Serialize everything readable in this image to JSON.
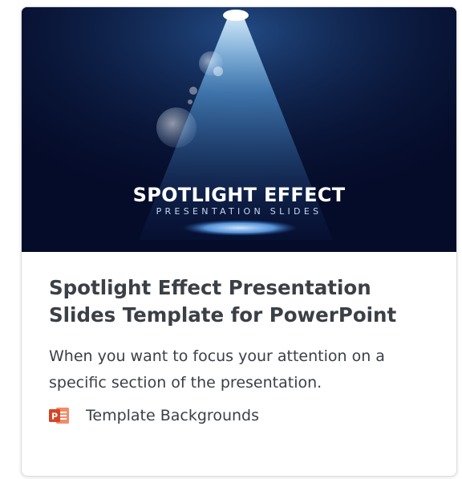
{
  "card": {
    "thumbnail": {
      "title": "SPOTLIGHT EFFECT",
      "subtitle": "PRESENTATION SLIDES",
      "background_color": "#050c2a"
    },
    "title": "Spotlight Effect Presentation Slides Template for PowerPoint",
    "description": "When you want to focus your attention on a specific section of the presentation.",
    "category": {
      "icon": "powerpoint-icon",
      "icon_color": "#d24726",
      "label": "Template Backgrounds"
    }
  }
}
